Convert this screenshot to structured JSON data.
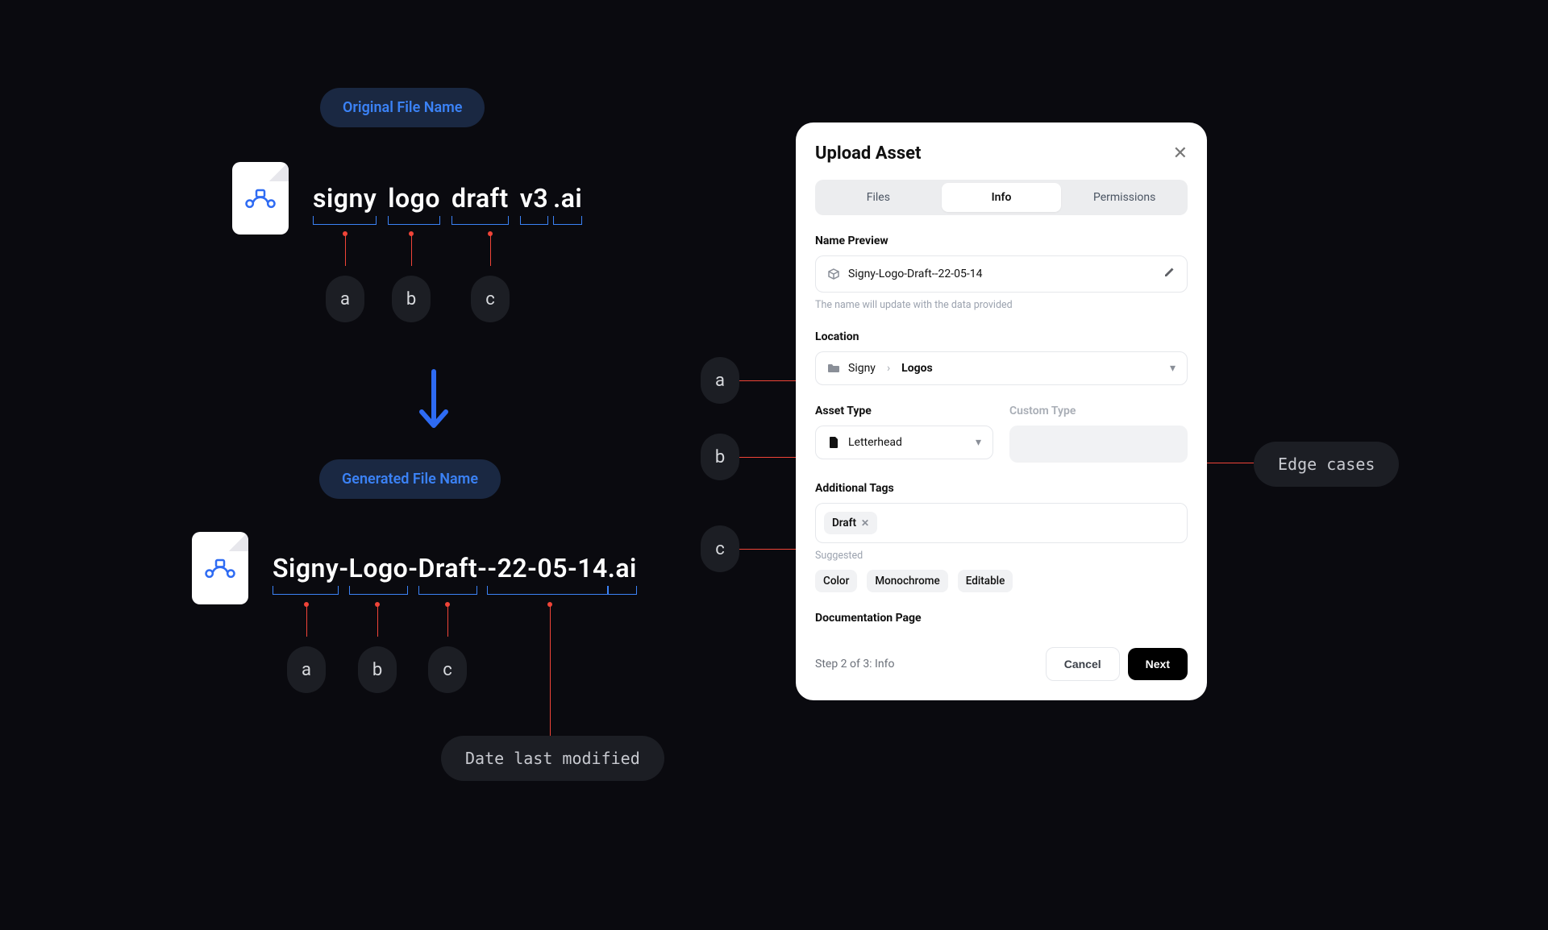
{
  "labels": {
    "original": "Original File Name",
    "generated": "Generated File Name",
    "date_note": "Date last modified",
    "edge_note": "Edge cases"
  },
  "tags": {
    "a": "a",
    "b": "b",
    "c": "c"
  },
  "original_file": {
    "parts": [
      "signy",
      "logo",
      "draft",
      "v3",
      ".ai"
    ],
    "full": "signy logo draft v3 .ai"
  },
  "generated_file": {
    "parts": [
      "Signy",
      "Logo",
      "Draft",
      "-22-05-14",
      ".ai"
    ],
    "full": "Signy-Logo-Draft--22-05-14.ai"
  },
  "modal": {
    "title": "Upload Asset",
    "tabs": [
      "Files",
      "Info",
      "Permissions"
    ],
    "active_tab": 1,
    "name_preview": {
      "section": "Name Preview",
      "value": "Signy-Logo-Draft--22-05-14",
      "hint": "The name will update with the data provided"
    },
    "location": {
      "section": "Location",
      "crumbs": [
        "Signy",
        "Logos"
      ]
    },
    "asset_type": {
      "section": "Asset Type",
      "value": "Letterhead",
      "custom_label": "Custom Type",
      "custom_value": ""
    },
    "tags": {
      "section": "Additional Tags",
      "applied": [
        "Draft"
      ],
      "suggested_label": "Suggested",
      "suggested": [
        "Color",
        "Monochrome",
        "Editable"
      ]
    },
    "doc_section": "Documentation Page",
    "footer": {
      "step": "Step 2 of 3: Info",
      "cancel": "Cancel",
      "next": "Next"
    }
  }
}
